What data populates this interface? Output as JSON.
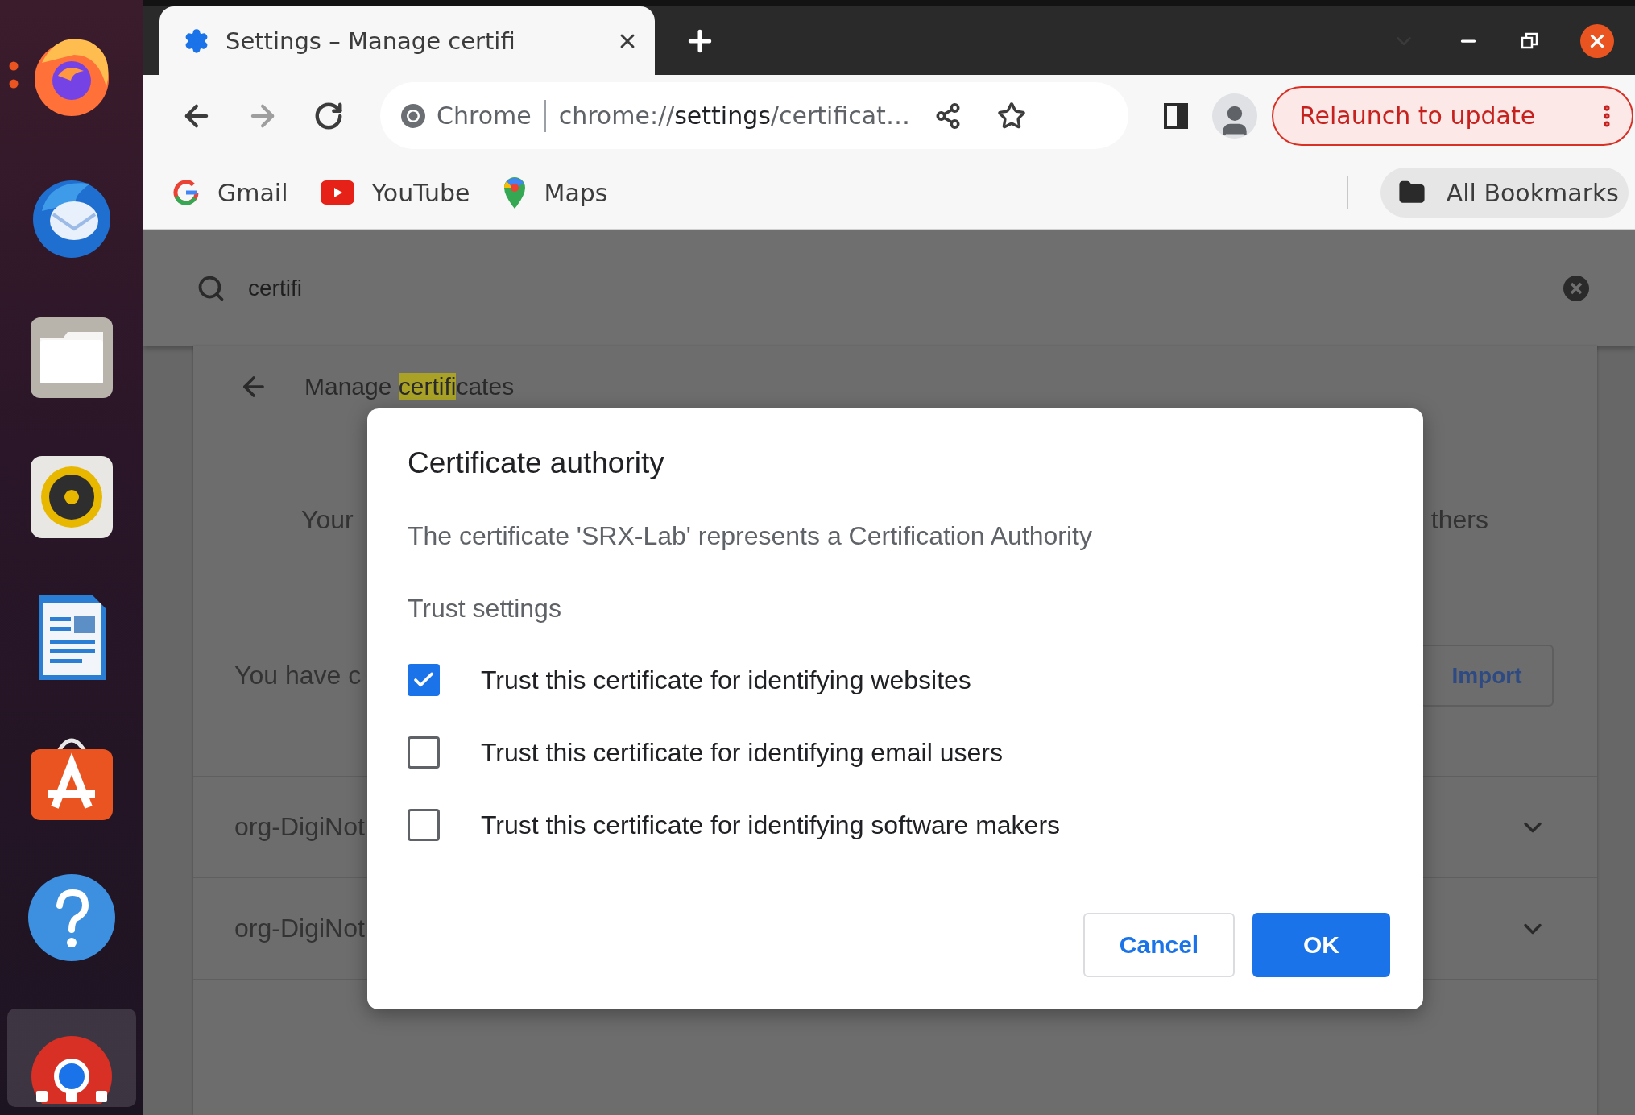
{
  "dock": {
    "items": [
      {
        "kind": "firefox",
        "running": true,
        "active": false
      },
      {
        "kind": "thunderbird",
        "running": false,
        "active": false
      },
      {
        "kind": "files",
        "running": false,
        "active": false
      },
      {
        "kind": "rhythmbox",
        "running": false,
        "active": false
      },
      {
        "kind": "writer",
        "running": false,
        "active": false
      },
      {
        "kind": "appcenter",
        "running": false,
        "active": false
      },
      {
        "kind": "help",
        "running": false,
        "active": false
      },
      {
        "kind": "chrome",
        "running": false,
        "active": true
      }
    ]
  },
  "browser": {
    "tab": {
      "title": "Settings – Manage certifi"
    },
    "omnibox": {
      "site_label": "Chrome",
      "url": [
        {
          "text": "chrome://",
          "kind": "dim"
        },
        {
          "text": "settings",
          "kind": "host"
        },
        {
          "text": "/certificat…",
          "kind": "dim"
        }
      ]
    },
    "relaunch_button": "Relaunch to update",
    "bookmarks": [
      {
        "label": "Gmail",
        "kind": "gmail"
      },
      {
        "label": "YouTube",
        "kind": "youtube"
      },
      {
        "label": "Maps",
        "kind": "maps"
      }
    ],
    "all_bookmarks": "All Bookmarks"
  },
  "settings": {
    "search": {
      "value": "certifi"
    },
    "page_title": [
      {
        "text": "Manage ",
        "highlighted": false
      },
      {
        "text": "certifi",
        "highlighted": true
      },
      {
        "text": "cates",
        "highlighted": false
      }
    ],
    "tab_left": "Your",
    "tab_right": "thers",
    "info": "You have c",
    "import_button": "Import",
    "rows": [
      {
        "name": "org-DigiNot"
      },
      {
        "name": "org-DigiNot"
      }
    ]
  },
  "dialog": {
    "title": "Certificate authority",
    "description": "The certificate 'SRX-Lab' represents a Certification Authority",
    "section": "Trust settings",
    "options": [
      {
        "label": "Trust this certificate for identifying websites",
        "checked": true
      },
      {
        "label": "Trust this certificate for identifying email users",
        "checked": false
      },
      {
        "label": "Trust this certificate for identifying software makers",
        "checked": false
      }
    ],
    "buttons": [
      {
        "label": "Cancel",
        "kind": "secondary"
      },
      {
        "label": "OK",
        "kind": "primary"
      }
    ]
  }
}
